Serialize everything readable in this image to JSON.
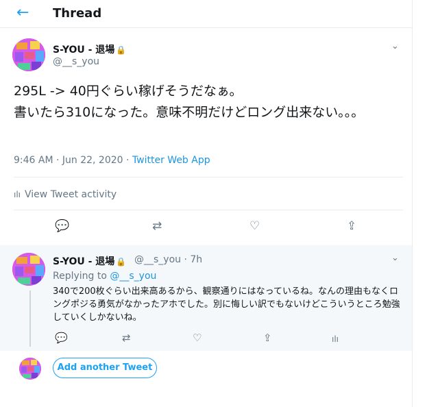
{
  "header": {
    "back_icon": "←",
    "title": "Thread"
  },
  "tweet": {
    "name": "S-YOU - 退場",
    "lock_icon": "🔒",
    "handle": "@__s_you",
    "caret": "⌄",
    "text": "295L -> 40円ぐらい稼げそうだなぁ。\n書いたら310になった。意味不明だけどロング出来ない。。。",
    "timestamp": "9:46 AM · Jun 22, 2020 · ",
    "source": "Twitter Web App",
    "activity_icon": "ılı",
    "activity_label": "View Tweet activity",
    "actions": {
      "reply": "💬",
      "retweet": "⇄",
      "like": "♡",
      "share": "⇪"
    }
  },
  "reply": {
    "name": "S-YOU - 退場",
    "lock_icon": "🔒",
    "handle_time": "@__s_you · 7h",
    "caret": "⌄",
    "replying_prefix": "Replying to ",
    "replying_handle": "@__s_you",
    "text": "340で200枚ぐらい出来高あるから、観察通りにはなっているね。なんの理由もなくロングポジる勇気がなかったアホでした。別に悔しい訳でもないけどこういうところ勉強していくしかないね。",
    "actions": {
      "reply": "💬",
      "retweet": "⇄",
      "like": "♡",
      "share": "⇪",
      "analytics": "ılı"
    }
  },
  "composer": {
    "add_label": "Add another Tweet"
  },
  "colors": {
    "accent": "#1da1f2",
    "link": "#1b95e0",
    "muted": "#657786",
    "border": "#e6ecf0"
  }
}
